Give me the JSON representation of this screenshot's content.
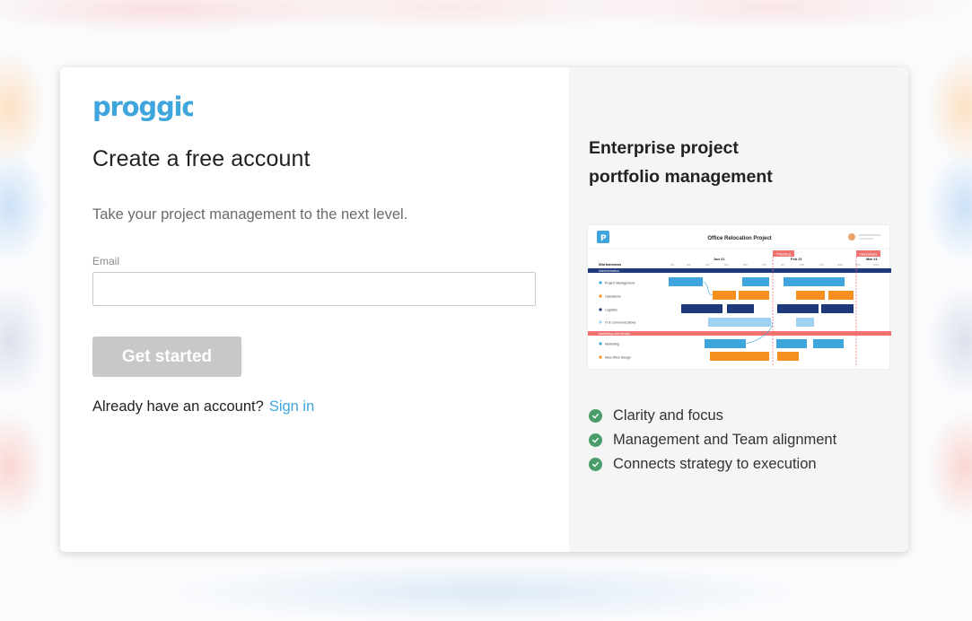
{
  "brand": {
    "logo_text": "proggio",
    "color": "#3ea6dc"
  },
  "signup": {
    "title": "Create a free account",
    "subtitle": "Take your project management to the next level.",
    "email_label": "Email",
    "email_value": "",
    "button_label": "Get started",
    "have_account_text": "Already have an account?",
    "signin_link": "Sign in"
  },
  "promo": {
    "heading_line1": "Enterprise project",
    "heading_line2": "portfolio management",
    "preview": {
      "title": "Office Relocation Project",
      "workstreams_label": "Workstreams",
      "months": [
        "Jan 21",
        "Feb 21",
        "Mar 21"
      ],
      "milestones": [
        "Planning",
        "Operations"
      ],
      "groups": [
        {
          "label": "Administration",
          "rows": [
            "Project Management",
            "Operations",
            "Logistics",
            "IT & Communications"
          ]
        },
        {
          "label": "Marketing and Design",
          "rows": [
            "Marketing",
            "New office Design"
          ]
        }
      ]
    },
    "features": [
      "Clarity and focus",
      "Management and Team alignment",
      "Connects strategy to execution"
    ]
  },
  "colors": {
    "check": "#4a9d6b",
    "button_disabled": "#c8c8c8",
    "link": "#3ea6dc"
  }
}
